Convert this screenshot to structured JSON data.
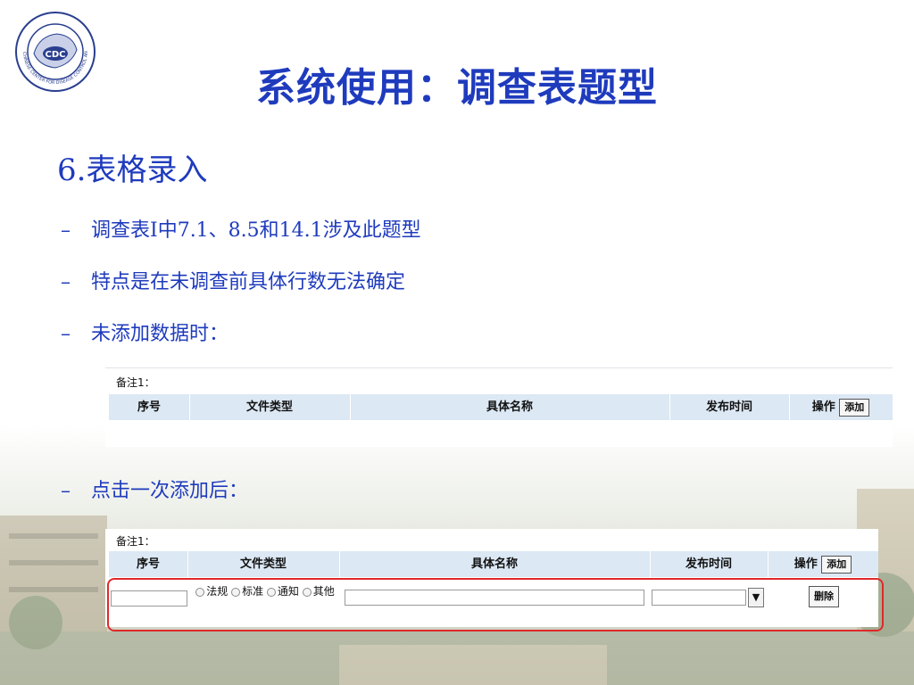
{
  "logo": {
    "center_text": "CDC",
    "ring_text": "CHINESE CENTER FOR DISEASE CONTROL AND PREVENTION"
  },
  "title": "系统使用：调查表题型",
  "section": "6.表格录入",
  "bullets": [
    {
      "dash": "–",
      "text": "调查表I中7.1、8.5和14.1涉及此题型"
    },
    {
      "dash": "–",
      "text": "特点是在未调查前具体行数无法确定"
    },
    {
      "dash": "–",
      "text": "未添加数据时："
    },
    {
      "dash": "–",
      "text": "点击一次添加后："
    }
  ],
  "table": {
    "note_label": "备注1：",
    "columns": [
      "序号",
      "文件类型",
      "具体名称",
      "发布时间",
      "操作"
    ],
    "add_label": "添加",
    "delete_label": "删除",
    "radio_options": [
      "法规",
      "标准",
      "通知",
      "其他"
    ],
    "dropdown_arrow": "▼"
  },
  "colors": {
    "title": "#1f3bbd",
    "header_bg": "#dce8f4",
    "highlight": "#e0292b"
  }
}
